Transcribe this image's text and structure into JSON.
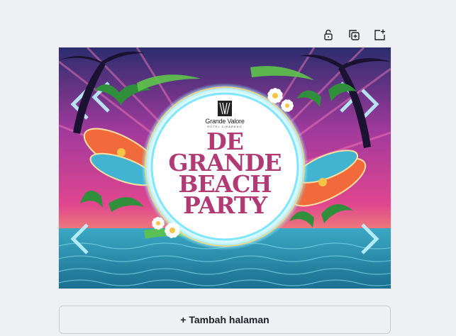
{
  "toolbar": {
    "lock_icon": "lock-icon",
    "duplicate_icon": "duplicate-page-icon",
    "add_icon": "add-page-icon"
  },
  "design": {
    "brand_name": "Grande Valore",
    "brand_sub": "HOTEL CIKARANG",
    "title_lines": [
      "DE",
      "GRANDE",
      "BEACH",
      "PARTY"
    ],
    "colors": {
      "title": "#b23a74",
      "sky_top": "#2b2d6e",
      "sky_pink": "#e0468f",
      "sea": "#1f8fb0",
      "neon": "#7fe6ff"
    }
  },
  "actions": {
    "add_page_label": "+ Tambah halaman"
  }
}
